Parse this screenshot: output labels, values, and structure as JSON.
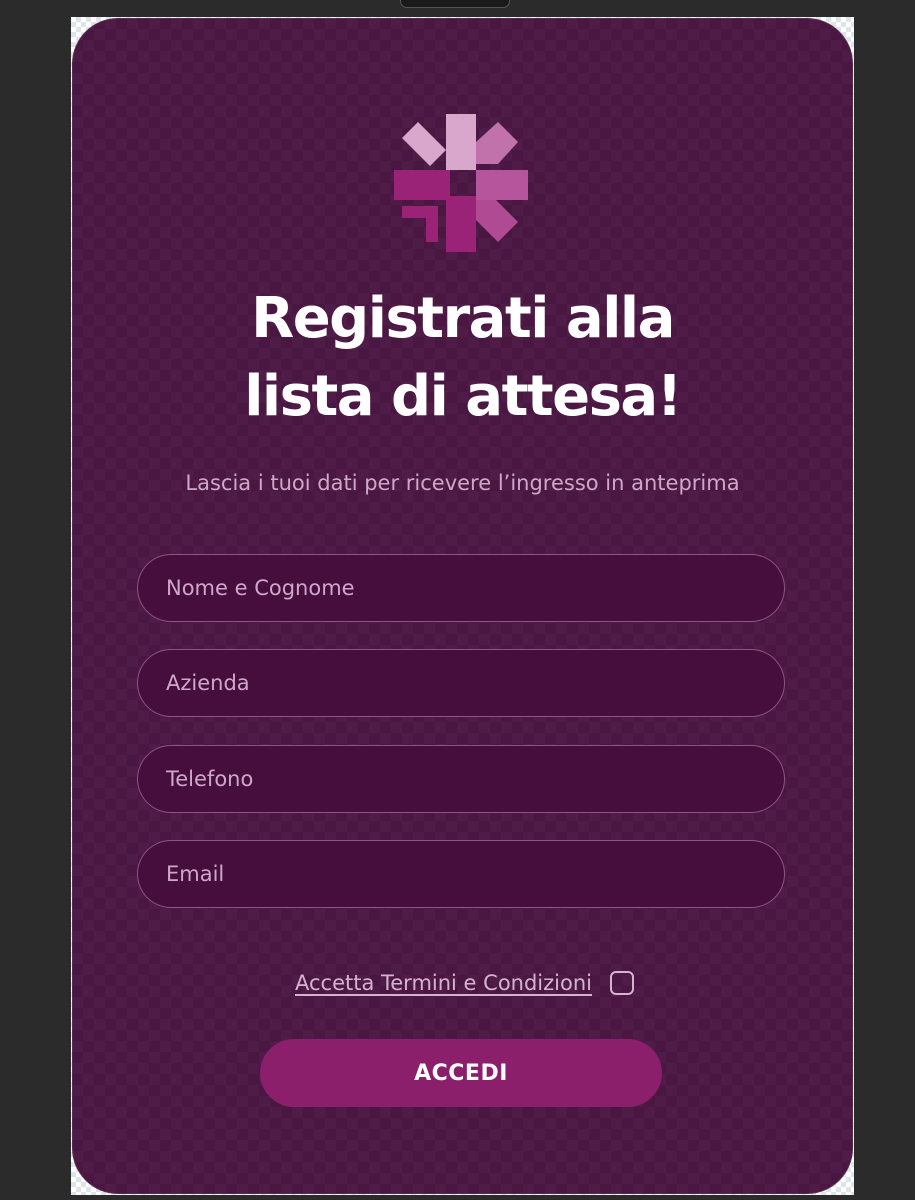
{
  "brand": {
    "logo_icon": "asterisk-arrow-logo",
    "colors": {
      "card_background": "#4a1742",
      "field_background": "#450e3d",
      "accent": "#8c1f6c",
      "logo_dark": "#9a2377",
      "logo_mid": "#b7559c",
      "logo_light": "#d9a6cc"
    }
  },
  "header": {
    "title_line1": "Registrati alla",
    "title_line2": "lista di attesa!",
    "subtitle": "Lascia i tuoi dati per ricevere l’ingresso in anteprima"
  },
  "form": {
    "name_placeholder": "Nome e Cognome",
    "company_placeholder": "Azienda",
    "phone_placeholder": "Telefono",
    "email_placeholder": "Email",
    "terms_label": "Accetta Termini e Condizioni",
    "terms_checked": false,
    "submit_label": "ACCEDI"
  }
}
